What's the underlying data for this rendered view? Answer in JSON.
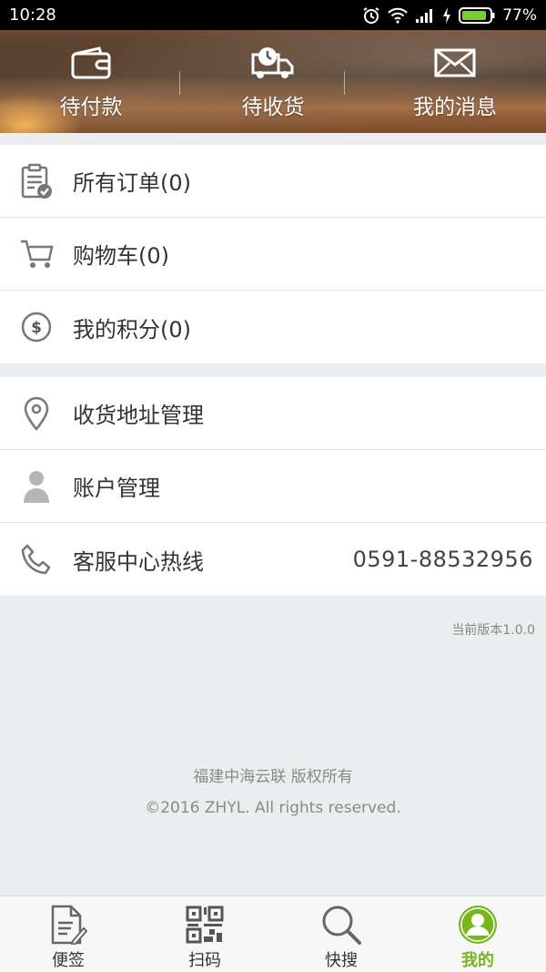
{
  "status_bar": {
    "time": "10:28",
    "battery": "77%",
    "icons": [
      "alarm-icon",
      "wifi-icon",
      "signal-icon",
      "charging-icon",
      "battery-icon"
    ]
  },
  "header": {
    "items": [
      {
        "label": "待付款",
        "icon": "wallet-icon"
      },
      {
        "label": "待收货",
        "icon": "delivery-truck-icon"
      },
      {
        "label": "我的消息",
        "icon": "envelope-icon"
      }
    ]
  },
  "menu_group_1": [
    {
      "label": "所有订单(0)",
      "icon": "clipboard-check-icon"
    },
    {
      "label": "购物车(0)",
      "icon": "cart-icon"
    },
    {
      "label": "我的积分(0)",
      "icon": "dollar-coin-icon"
    }
  ],
  "menu_group_2": [
    {
      "label": "收货地址管理",
      "icon": "location-pin-icon"
    },
    {
      "label": "账户管理",
      "icon": "person-icon"
    },
    {
      "label": "客服中心热线",
      "icon": "phone-icon",
      "value": "0591-88532956"
    }
  ],
  "version": "当前版本1.0.0",
  "footer": {
    "line1": "福建中海云联 版权所有",
    "line2": "©2016 ZHYL. All rights reserved."
  },
  "bottom_nav": [
    {
      "label": "便签",
      "icon": "note-icon"
    },
    {
      "label": "扫码",
      "icon": "qr-code-icon"
    },
    {
      "label": "快搜",
      "icon": "search-icon"
    },
    {
      "label": "我的",
      "icon": "profile-icon",
      "active": true
    }
  ],
  "colors": {
    "accent": "#78b51e",
    "background": "#ebeeee",
    "status_bar": "#000000"
  }
}
